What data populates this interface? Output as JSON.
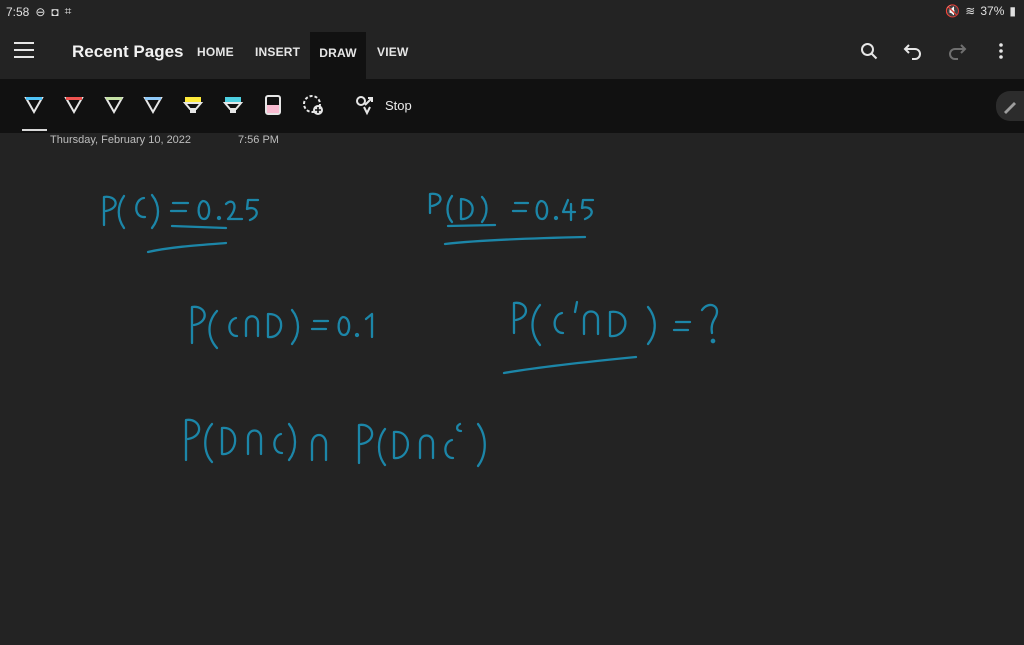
{
  "status": {
    "time": "7:58",
    "battery": "37%"
  },
  "appbar": {
    "title": "Recent Pages",
    "tabs": [
      "HOME",
      "INSERT",
      "DRAW",
      "VIEW"
    ],
    "active_tab": "DRAW"
  },
  "toolbar": {
    "pens": [
      {
        "name": "pen-cyan",
        "color": "#4fc3f7"
      },
      {
        "name": "pen-red",
        "color": "#ef5350"
      },
      {
        "name": "pen-green",
        "color": "#c5e1a5"
      },
      {
        "name": "pen-blue",
        "color": "#90caf9"
      },
      {
        "name": "highlighter-yellow",
        "color": "#ffeb3b"
      },
      {
        "name": "highlighter-cyan",
        "color": "#4dd0e1"
      },
      {
        "name": "highlighter-pink",
        "color": "#f8bbd0"
      }
    ],
    "stop_label": "Stop"
  },
  "page": {
    "date": "Thursday, February 10, 2022",
    "time": "7:56 PM"
  },
  "ink": {
    "color": "#1c86a8",
    "lines": [
      "P(C) = 0.25",
      "P(D) = 0.45",
      "P(C∩D) = 0.1",
      "P(C'∩D) = ?",
      "P(D∩C) ∩ P(D∩C^c)"
    ]
  }
}
